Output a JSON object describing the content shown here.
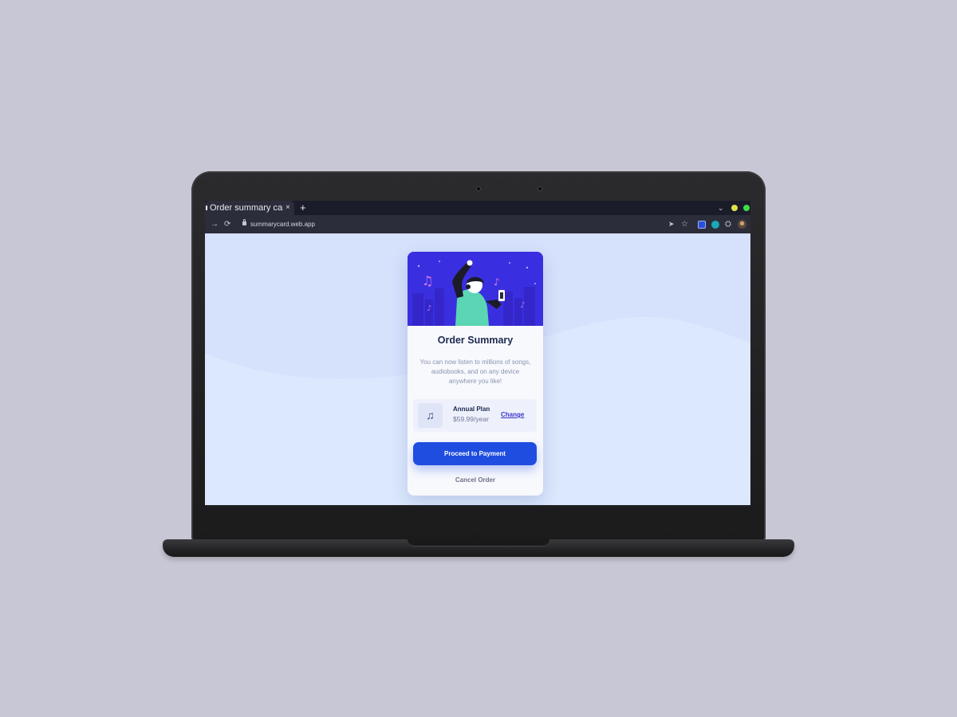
{
  "browser": {
    "tab_title": "Order summary card",
    "tab_close": "×",
    "new_tab": "+",
    "url": "summarycard.web.app",
    "window_controls": {
      "minimize_color": "#e0e04a",
      "maximize_color": "#3fdc4a"
    },
    "icons": [
      "forward-icon",
      "reload-icon",
      "lock-icon",
      "send-icon",
      "star-icon",
      "extension-icon",
      "puzzle-icon",
      "profile-avatar-icon"
    ]
  },
  "card": {
    "title": "Order Summary",
    "description": "You can now listen to millions of songs, audiobooks, and on any device anywhere you like!",
    "plan": {
      "icon": "music-note-icon",
      "name": "Annual Plan",
      "price": "$59.99/year",
      "change_label": "Change"
    },
    "pay_button": "Proceed to Payment",
    "cancel_label": "Cancel Order"
  },
  "colors": {
    "background": "#c8c7d5",
    "page_bg": "#d6e1fc",
    "hero_bg": "#3a2fe0",
    "primary": "#1f4de0",
    "title": "#1d2a4f",
    "link": "#3b34cc"
  }
}
